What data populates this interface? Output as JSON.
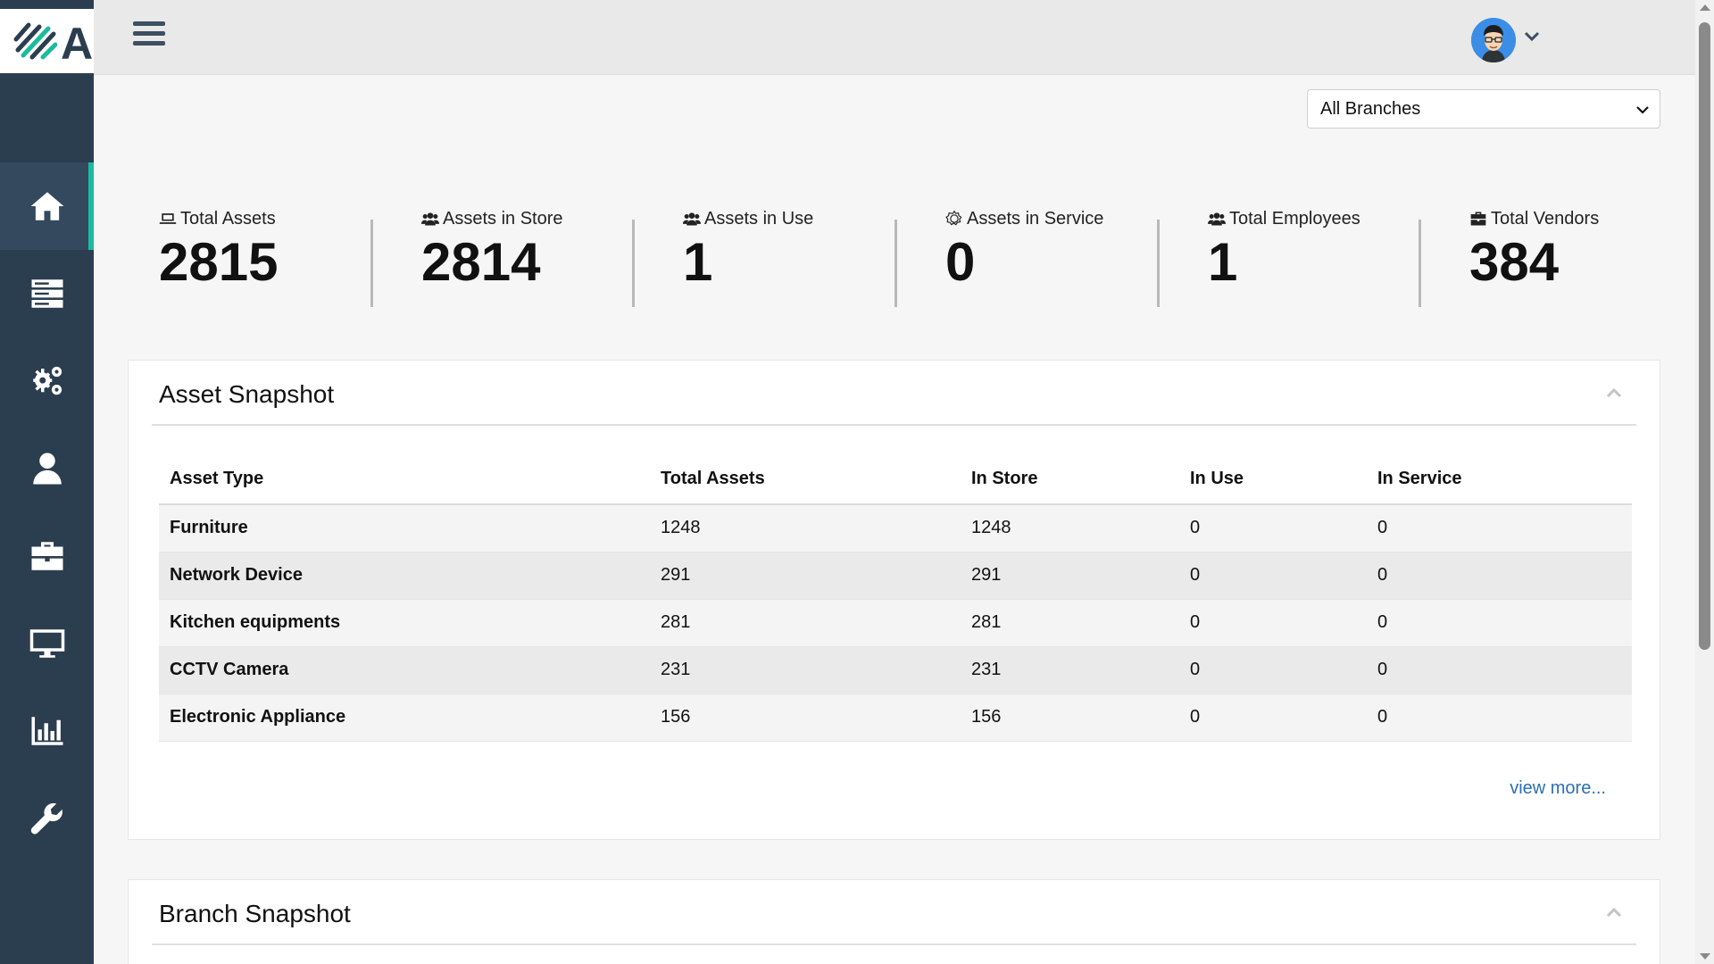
{
  "brand": {
    "logo_text": "A"
  },
  "sidebar": {
    "items": [
      {
        "name": "home",
        "icon": "home-icon",
        "active": true
      },
      {
        "name": "assets",
        "icon": "server-icon",
        "active": false
      },
      {
        "name": "settings",
        "icon": "gears-icon",
        "active": false
      },
      {
        "name": "users",
        "icon": "user-icon",
        "active": false
      },
      {
        "name": "vendors",
        "icon": "briefcase-icon",
        "active": false
      },
      {
        "name": "devices",
        "icon": "desktop-icon",
        "active": false
      },
      {
        "name": "reports",
        "icon": "bar-chart-icon",
        "active": false
      },
      {
        "name": "tools",
        "icon": "wrench-icon",
        "active": false
      }
    ]
  },
  "topbar": {
    "menu_icon": "hamburger-icon",
    "avatar_icon": "user-avatar-icon",
    "caret_icon": "chevron-down-icon"
  },
  "filter": {
    "branch_selected": "All Branches"
  },
  "stats": {
    "total_assets": {
      "label": "Total Assets",
      "value": "2815",
      "icon": "laptop-icon"
    },
    "assets_in_store": {
      "label": "Assets in Store",
      "value": "2814",
      "icon": "users-icon"
    },
    "assets_in_use": {
      "label": "Assets in Use",
      "value": "1",
      "icon": "users-icon"
    },
    "assets_in_service": {
      "label": "Assets in Service",
      "value": "0",
      "icon": "service-gear-icon"
    },
    "total_employees": {
      "label": "Total Employees",
      "value": "1",
      "icon": "users-icon"
    },
    "total_vendors": {
      "label": "Total Vendors",
      "value": "384",
      "icon": "briefcase-icon"
    }
  },
  "asset_snapshot": {
    "title": "Asset Snapshot",
    "columns": [
      "Asset Type",
      "Total Assets",
      "In Store",
      "In Use",
      "In Service"
    ],
    "rows": [
      [
        "Furniture",
        "1248",
        "1248",
        "0",
        "0"
      ],
      [
        "Network Device",
        "291",
        "291",
        "0",
        "0"
      ],
      [
        "Kitchen equipments",
        "281",
        "281",
        "0",
        "0"
      ],
      [
        "CCTV Camera",
        "231",
        "231",
        "0",
        "0"
      ],
      [
        "Electronic Appliance",
        "156",
        "156",
        "0",
        "0"
      ]
    ],
    "view_more": "view more..."
  },
  "branch_snapshot": {
    "title": "Branch Snapshot"
  },
  "colors": {
    "sidebar_bg": "#2b3e50",
    "active_accent": "#1abc9c",
    "link": "#2a6fb5"
  }
}
